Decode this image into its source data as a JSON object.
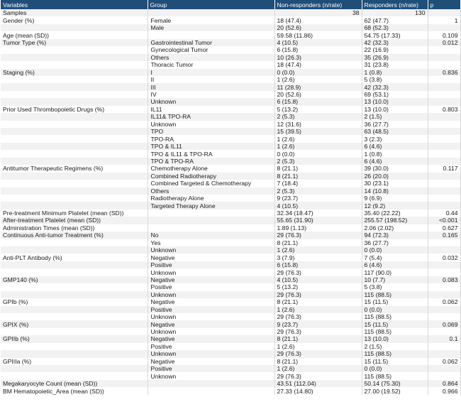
{
  "headers": [
    "Variables",
    "Group",
    "Non-responders (n/rate)",
    "Responders (n/rate)",
    "p"
  ],
  "samples": {
    "label": "Samples",
    "non": "38",
    "resp": "130"
  },
  "rows": [
    {
      "v": "Gender (%)",
      "g": "Female",
      "a": "18 (47.4)",
      "b": "62 (47.7)",
      "p": "1"
    },
    {
      "v": "",
      "g": "Male",
      "a": "20 (52.6)",
      "b": "68 (52.3)",
      "p": ""
    },
    {
      "v": "Age (mean (SD))",
      "g": "",
      "a": "59.58 (11.86)",
      "b": "54.75 (17.33)",
      "p": "0.109"
    },
    {
      "v": "Tumor Type (%)",
      "g": "Gastrointestinal Tumor",
      "a": "4 (10.5)",
      "b": "42 (32.3)",
      "p": "0.012"
    },
    {
      "v": "",
      "g": "Gynecological Tumor",
      "a": "6 (15.8)",
      "b": "22 (16.9)",
      "p": ""
    },
    {
      "v": "",
      "g": "Others",
      "a": "10 (26.3)",
      "b": "35 (26.9)",
      "p": ""
    },
    {
      "v": "",
      "g": "Thoracic Tumor",
      "a": "18 (47.4)",
      "b": "31 (23.8)",
      "p": ""
    },
    {
      "v": "Staging (%)",
      "g": "I",
      "a": "0 (0.0)",
      "b": "1 (0.8)",
      "p": "0.836"
    },
    {
      "v": "",
      "g": "II",
      "a": "1 (2.6)",
      "b": "5 (3.8)",
      "p": ""
    },
    {
      "v": "",
      "g": "III",
      "a": "11 (28.9)",
      "b": "42 (32.3)",
      "p": ""
    },
    {
      "v": "",
      "g": "IV",
      "a": "20 (52.6)",
      "b": "69 (53.1)",
      "p": ""
    },
    {
      "v": "",
      "g": "Unknown",
      "a": "6 (15.8)",
      "b": "13 (10.0)",
      "p": ""
    },
    {
      "v": "Prior Used Thrombopoietic Drugs (%)",
      "g": "IL11",
      "a": "5 (13.2)",
      "b": "13 (10.0)",
      "p": "0.803"
    },
    {
      "v": "",
      "g": "IL11& TPO-RA",
      "a": "2 (5.3)",
      "b": "2 (1.5)",
      "p": ""
    },
    {
      "v": "",
      "g": "Unknown",
      "a": "12 (31.6)",
      "b": "36 (27.7)",
      "p": ""
    },
    {
      "v": "",
      "g": "TPO",
      "a": "15 (39.5)",
      "b": "63 (48.5)",
      "p": ""
    },
    {
      "v": "",
      "g": "TPO-RA",
      "a": "1 (2.6)",
      "b": "3 (2.3)",
      "p": ""
    },
    {
      "v": "",
      "g": "TPO & IL11",
      "a": "1 (2.6)",
      "b": "6 (4.6)",
      "p": ""
    },
    {
      "v": "",
      "g": "TPO & IL11 & TPO-RA",
      "a": "0 (0.0)",
      "b": "1 (0.8)",
      "p": ""
    },
    {
      "v": "",
      "g": "TPO & TPO-RA",
      "a": "2 (5.3)",
      "b": "6 (4.6)",
      "p": ""
    },
    {
      "v": "Antitumor Therapeutic Regimens (%)",
      "g": "Chemotherapy Alone",
      "a": "8 (21.1)",
      "b": "39 (30.0)",
      "p": "0.117"
    },
    {
      "v": "",
      "g": "Combined Radiotherapy",
      "a": "8 (21.1)",
      "b": "26 (20.0)",
      "p": ""
    },
    {
      "v": "",
      "g": "Combined Targeted & Chemotherapy",
      "a": "7 (18.4)",
      "b": "30 (23.1)",
      "p": ""
    },
    {
      "v": "",
      "g": "Others",
      "a": "2 (5.3)",
      "b": "14 (10.8)",
      "p": ""
    },
    {
      "v": "",
      "g": "Radiotherapy Alone",
      "a": "9 (23.7)",
      "b": "9 (6.9)",
      "p": ""
    },
    {
      "v": "",
      "g": "Targeted Therapy Alone",
      "a": "4 (10.5)",
      "b": "12 (9.2)",
      "p": ""
    },
    {
      "v": "Pre-treatment Minimum Platelet (mean (SD))",
      "g": "",
      "a": "32.34 (18.47)",
      "b": "35.40 (22.22)",
      "p": "0.44"
    },
    {
      "v": "After-treatment Platelet (mean (SD))",
      "g": "",
      "a": "55.65 (31.90)",
      "b": "255.57 (198.52)",
      "p": "<0.001"
    },
    {
      "v": "Administration Times (mean (SD))",
      "g": "",
      "a": "1.89 (1.13)",
      "b": "2.06 (2.02)",
      "p": "0.627"
    },
    {
      "v": "Continuous Anti-tumor Treatment (%)",
      "g": "No",
      "a": "29 (76.3)",
      "b": "94 (72.3)",
      "p": "0.165"
    },
    {
      "v": "",
      "g": "Yes",
      "a": "8 (21.1)",
      "b": "36 (27.7)",
      "p": ""
    },
    {
      "v": "",
      "g": "Unknown",
      "a": "1 (2.6)",
      "b": "0 (0.0)",
      "p": ""
    },
    {
      "v": "Anti-PLT Antibody (%)",
      "g": "Negative",
      "a": "3 (7.9)",
      "b": "7 (5.4)",
      "p": "0.032"
    },
    {
      "v": "",
      "g": "Positive",
      "a": "6 (15.8)",
      "b": "6 (4.6)",
      "p": ""
    },
    {
      "v": "",
      "g": "Unknown",
      "a": "29 (76.3)",
      "b": "117 (90.0)",
      "p": ""
    },
    {
      "v": "GMP140 (%)",
      "g": "Negative",
      "a": "4 (10.5)",
      "b": "10 (7.7)",
      "p": "0.083"
    },
    {
      "v": "",
      "g": "Positive",
      "a": "5 (13.2)",
      "b": "5 (3.8)",
      "p": ""
    },
    {
      "v": "",
      "g": "Unknown",
      "a": "29 (76.3)",
      "b": "115 (88.5)",
      "p": ""
    },
    {
      "v": "GPIb (%)",
      "g": "Negative",
      "a": "8 (21.1)",
      "b": "15 (11.5)",
      "p": "0.062"
    },
    {
      "v": "",
      "g": "Positive",
      "a": "1 (2.6)",
      "b": "0 (0.0)",
      "p": ""
    },
    {
      "v": "",
      "g": "Unknown",
      "a": "29 (76.3)",
      "b": "115 (88.5)",
      "p": ""
    },
    {
      "v": "GPIX (%)",
      "g": "Negative",
      "a": "9 (23.7)",
      "b": "15 (11.5)",
      "p": "0.069"
    },
    {
      "v": "",
      "g": "Unknown",
      "a": "29 (76.3)",
      "b": "115 (88.5)",
      "p": ""
    },
    {
      "v": "GPIIb (%)",
      "g": "Negative",
      "a": "8 (21.1)",
      "b": "13 (10.0)",
      "p": "0.1"
    },
    {
      "v": "",
      "g": "Positive",
      "a": "1 (2.6)",
      "b": "2 (1.5)",
      "p": ""
    },
    {
      "v": "",
      "g": "Unknown",
      "a": "29 (76.3)",
      "b": "115 (88.5)",
      "p": ""
    },
    {
      "v": "GPIIIa (%)",
      "g": "Negative",
      "a": "8 (21.1)",
      "b": "15 (11.5)",
      "p": "0.062"
    },
    {
      "v": "",
      "g": "Positive",
      "a": "1 (2.6)",
      "b": "0 (0.0)",
      "p": ""
    },
    {
      "v": "",
      "g": "Unknown",
      "a": "29 (76.3)",
      "b": "115 (88.5)",
      "p": ""
    },
    {
      "v": "Megakaryocyte Count (mean (SD))",
      "g": "",
      "a": "43.51 (112.04)",
      "b": "50.14 (75.30)",
      "p": "0.864"
    },
    {
      "v": "BM Hematopoietic_Area (mean (SD))",
      "g": "",
      "a": "27.33 (14.80)",
      "b": "27.00 (19.52)",
      "p": "0.966"
    }
  ]
}
